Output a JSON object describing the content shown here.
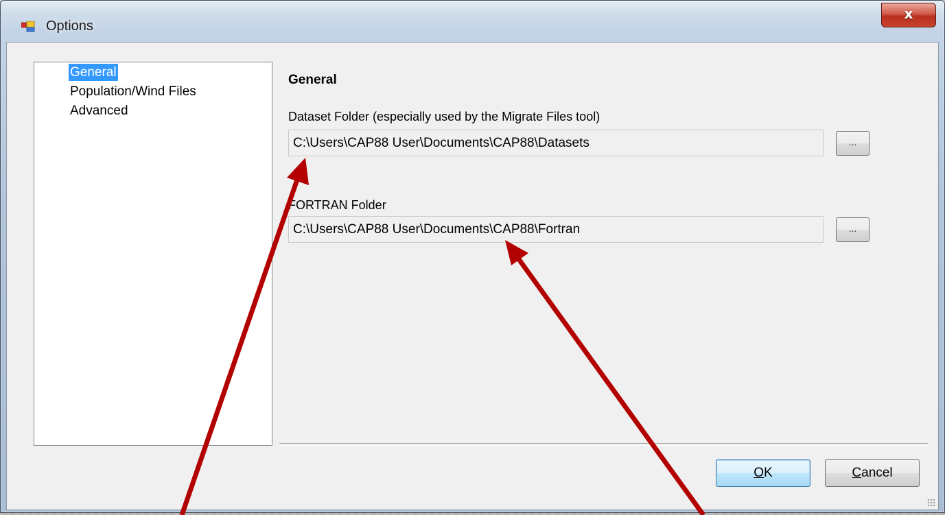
{
  "window": {
    "title": "Options",
    "close_label": "x",
    "icon": "options-window-icon"
  },
  "tree": {
    "items": [
      {
        "label": "General",
        "selected": true
      },
      {
        "label": "Population/Wind Files",
        "selected": false
      },
      {
        "label": "Advanced",
        "selected": false
      }
    ]
  },
  "panel": {
    "heading": "General",
    "dataset_folder": {
      "label": "Dataset Folder (especially used by the Migrate Files tool)",
      "value": "C:\\Users\\CAP88 User\\Documents\\CAP88\\Datasets",
      "browse_label": "..."
    },
    "fortran_folder": {
      "label": "FORTRAN Folder",
      "value": "C:\\Users\\CAP88 User\\Documents\\CAP88\\Fortran",
      "browse_label": "..."
    }
  },
  "buttons": {
    "ok_mnemonic": "O",
    "ok_rest": "K",
    "cancel_mnemonic": "C",
    "cancel_rest": "ancel"
  },
  "colors": {
    "selection": "#3399ff",
    "annotation_arrow": "#b30000",
    "close_button": "#c8422d"
  }
}
